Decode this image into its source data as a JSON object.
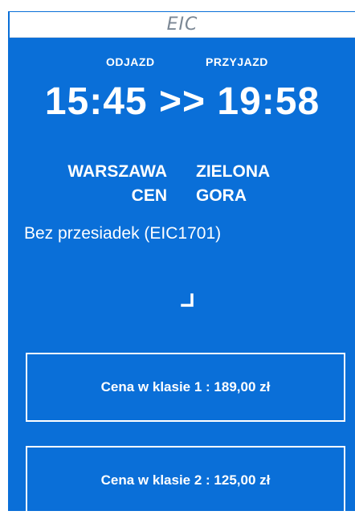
{
  "brand": {
    "name": "EIC"
  },
  "journey": {
    "departure_label": "ODJAZD",
    "arrival_label": "PRZYJAZD",
    "departure_time": "15:45",
    "separator": ">>",
    "arrival_time": "19:58",
    "from_city_line1": "WARSZAWA",
    "from_city_line2": "CEN",
    "to_city_line1": "ZIELONA",
    "to_city_line2": "GORA",
    "connection_info": "Bez przesiadek (EIC1701)"
  },
  "prices": [
    {
      "label": "Cena w klasie 1 : ",
      "value": "189,00 zł"
    },
    {
      "label": "Cena w klasie 2 : ",
      "value": "125,00 zł"
    }
  ],
  "icons": {
    "loading": "loading-spinner-icon"
  },
  "colors": {
    "panel_bg": "#0a6fd8",
    "text": "#ffffff",
    "brand_text": "#7b8794"
  }
}
